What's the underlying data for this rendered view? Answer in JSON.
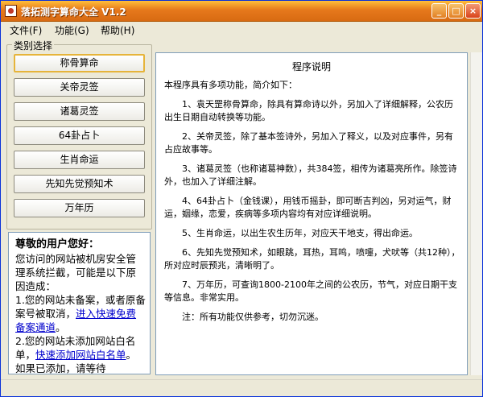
{
  "window": {
    "title": "落拓测字算命大全 V1.2",
    "minimize_glyph": "_",
    "maximize_glyph": "□",
    "close_glyph": "×"
  },
  "menu": [
    "文件(F)",
    "功能(G)",
    "帮助(H)"
  ],
  "sidebar": {
    "group_label": "类别选择",
    "buttons": [
      "称骨算命",
      "关帝灵签",
      "诸葛灵签",
      "64卦占卜",
      "生肖命运",
      "先知先觉预知术",
      "万年历"
    ],
    "selected_index": 0
  },
  "notice": {
    "heading": "尊敬的用户您好：",
    "p1": "您访问的网站被机房安全管理系统拦截，可能是以下原因造成：",
    "p2_text": "1.您的网站未备案，或者原备案号被取消，",
    "p2_link": "进入快速免费备案通道",
    "p2_end": "。",
    "p3_text": "2.您的网站未添加网站白名单，",
    "p3_link": "快速添加网站白名单",
    "p3_end": "。如果已添加，请等待"
  },
  "main": {
    "title": "程序说明",
    "intro": "本程序具有多项功能，简介如下：",
    "items": [
      "1、袁天罡称骨算命，除具有算命诗以外，另加入了详细解释，公农历出生日期自动转换等功能。",
      "2、关帝灵签，除了基本签诗外，另加入了释义，以及对应事件，另有占应故事等。",
      "3、诸葛灵签（也称诸葛神数），共384签，相传为诸葛亮所作。除签诗外，也加入了详细注解。",
      "4、64卦占卜（金钱课），用钱币摇卦，即可断吉判凶，另对运气，财运，姻缘，恋爱，疾病等多项内容均有对应详细说明。",
      "5、生肖命运，以出生农生历年，对应天干地支，得出命运。",
      "6、先知先觉预知术，如眼跳，耳热，耳鸣，喷嚏，犬吠等（共12种），所对应时辰预兆，清晰明了。",
      "7、万年历，可查询1800-2100年之间的公农历，节气，对应日期干支等信息。非常实用。"
    ],
    "note": "注：所有功能仅供参考，切勿沉迷。"
  }
}
